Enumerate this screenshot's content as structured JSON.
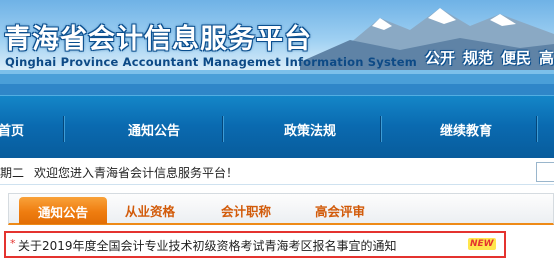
{
  "header": {
    "title": "青海省会计信息服务平台",
    "subtitle": "Qinghai Province Accountant Managemet Information System",
    "slogans": [
      "公开",
      "规范",
      "便民",
      "高"
    ]
  },
  "nav": {
    "items": [
      "首页",
      "通知公告",
      "政策法规",
      "继续教育"
    ]
  },
  "welcome": {
    "weekday": "期二",
    "message": "欢迎您进入青海省会计信息服务平台！"
  },
  "tabs": [
    "通知公告",
    "从业资格",
    "会计职称",
    "高会评审"
  ],
  "notice": {
    "bullet": "*",
    "text": "关于2019年度全国会计专业技术初级资格考试青海考区报名事宜的通知",
    "badge": "NEW"
  },
  "colors": {
    "nav_blue": "#0a6ab0",
    "tab_orange": "#ef7d10",
    "highlight_red": "#e4332f"
  }
}
